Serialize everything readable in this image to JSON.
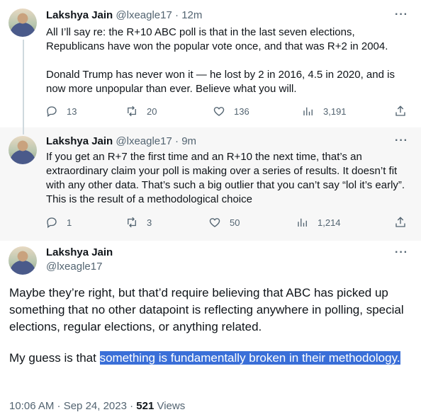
{
  "tweets": [
    {
      "name": "Lakshya Jain",
      "handle": "@lxeagle17",
      "time": "12m",
      "paragraphs": [
        "All I’ll say re: the R+10 ABC poll is that in the last seven elections, Republicans have won the popular vote once, and that was R+2 in 2004.",
        "Donald Trump has never won it — he lost by 2 in 2016, 4.5 in 2020, and is now more unpopular than ever. Believe what you will."
      ],
      "replies": "13",
      "retweets": "20",
      "likes": "136",
      "views": "3,191"
    },
    {
      "name": "Lakshya Jain",
      "handle": "@lxeagle17",
      "time": "9m",
      "paragraphs": [
        "If you get an R+7 the first time and an R+10 the next time, that’s an extraordinary claim your poll is making over a series of results. It doesn’t fit with any other data. That’s such a big outlier that you can’t say “lol it’s early”. This is the result of a methodological choice"
      ],
      "replies": "1",
      "retweets": "3",
      "likes": "50",
      "views": "1,214"
    }
  ],
  "main": {
    "name": "Lakshya Jain",
    "handle": "@lxeagle17",
    "paragraph1": "Maybe they’re right, but that’d require believing that ABC has picked up something that no other datapoint is reflecting anywhere in polling, special elections, regular elections, or anything related.",
    "paragraph2_plain": "My guess is that ",
    "paragraph2_highlight": "something is fundamentally broken in their methodology.",
    "timestamp": "10:06 AM · Sep 24, 2023 · ",
    "views_count": "521",
    "views_label": " Views"
  },
  "separator": " · ",
  "more_label": "···",
  "colors": {
    "highlight": "#3a6fd8",
    "secondary_text": "#536471",
    "thread_line": "#cfd9de"
  }
}
